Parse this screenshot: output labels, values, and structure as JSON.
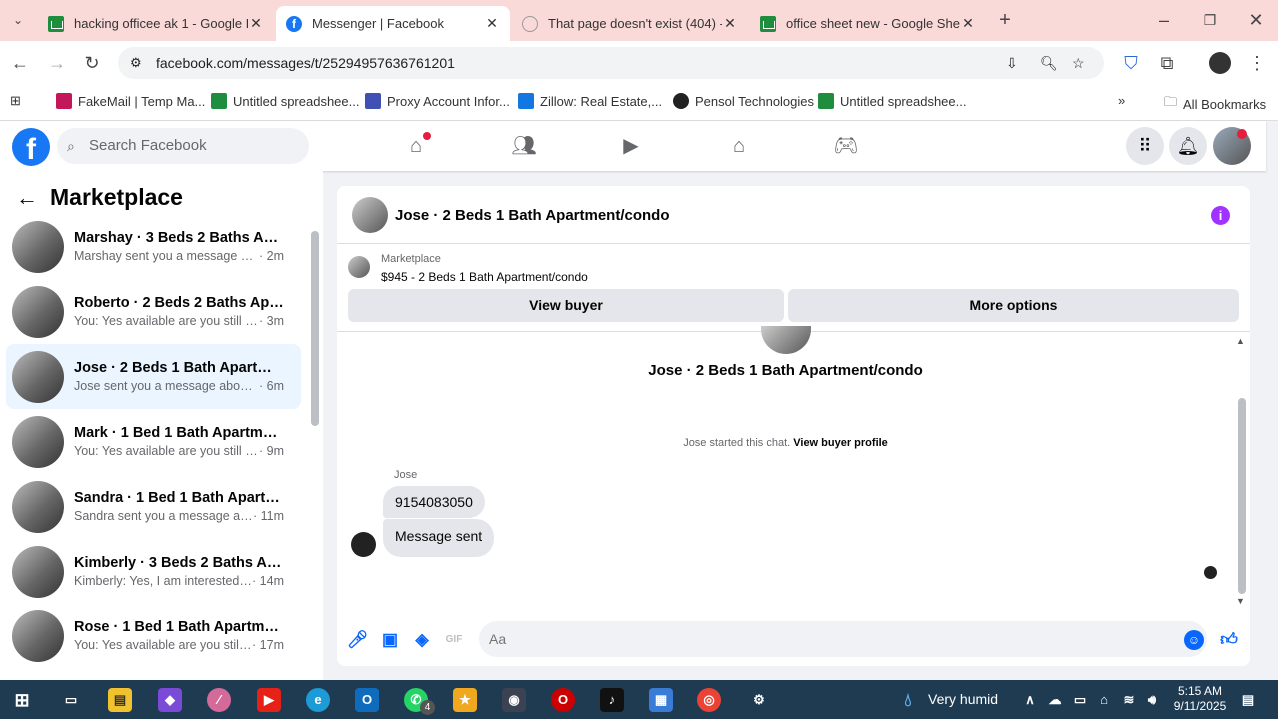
{
  "browser": {
    "tabs": [
      {
        "title": "hacking officee ak 1 - Google D",
        "icon": "sheets-icon"
      },
      {
        "title": "Messenger | Facebook",
        "icon": "facebook-icon"
      },
      {
        "title": "That page doesn't exist (404) -",
        "icon": "page-error-icon"
      },
      {
        "title": "office sheet new - Google Shee",
        "icon": "sheets-icon"
      }
    ],
    "url": "facebook.com/messages/t/25294957636761201",
    "bookmarks": [
      {
        "label": "FakeMail | Temp Ma...",
        "color": "#c2185b"
      },
      {
        "label": "Untitled spreadshee...",
        "color": "#1e8e3e"
      },
      {
        "label": "Proxy Account Infor...",
        "color": "#3f51b5"
      },
      {
        "label": "Zillow: Real Estate,...",
        "color": "#1277e1"
      },
      {
        "label": "Pensol Technologies",
        "color": "#222222"
      },
      {
        "label": "Untitled spreadshee...",
        "color": "#1e8e3e"
      }
    ],
    "all_bookmarks": "All Bookmarks"
  },
  "fb": {
    "logo": "f",
    "search_placeholder": "Search Facebook"
  },
  "sidebar": {
    "title": "Marketplace",
    "conversations": [
      {
        "name": "Marshay · 3 Beds 2 Baths Apart...",
        "preview": "Marshay sent you a message abou...",
        "time": "· 2m"
      },
      {
        "name": "Roberto · 2 Beds 2 Baths Apart...",
        "preview": "You: Yes available are you still inter...",
        "time": "· 3m"
      },
      {
        "name": "Jose · 2 Beds 1 Bath Apartment/...",
        "preview": "Jose sent you a message about yo...",
        "time": "· 6m"
      },
      {
        "name": "Mark · 1 Bed 1 Bath Apartment/...",
        "preview": "You: Yes available are you still inter...",
        "time": "· 9m"
      },
      {
        "name": "Sandra · 1 Bed 1 Bath Apartment...",
        "preview": "Sandra sent you a message abou...",
        "time": "· 11m"
      },
      {
        "name": "Kimberly · 3 Beds 2 Baths Apart...",
        "preview": "Kimberly: Yes, I am interested. M...",
        "time": "· 14m"
      },
      {
        "name": "Rose · 1 Bed 1 Bath Apartment/c...",
        "preview": "You: Yes available are you still int...",
        "time": "· 17m"
      }
    ]
  },
  "chat": {
    "header_name": "Jose · 2 Beds 1 Bath Apartment/condo",
    "marketplace_label": "Marketplace",
    "listing": "$945 - 2 Beds 1 Bath Apartment/condo",
    "view_buyer": "View buyer",
    "more_options": "More options",
    "center_name": "Jose · 2 Beds 1 Bath Apartment/condo",
    "started_text": "Jose started this chat.",
    "view_profile": "View buyer profile",
    "sender": "Jose",
    "messages": [
      "9154083050",
      "Message sent"
    ],
    "input_placeholder": "Aa"
  },
  "taskbar": {
    "weather": "Very humid",
    "time": "5:15 AM",
    "date": "9/11/2025",
    "whatsapp_badge": "4"
  }
}
